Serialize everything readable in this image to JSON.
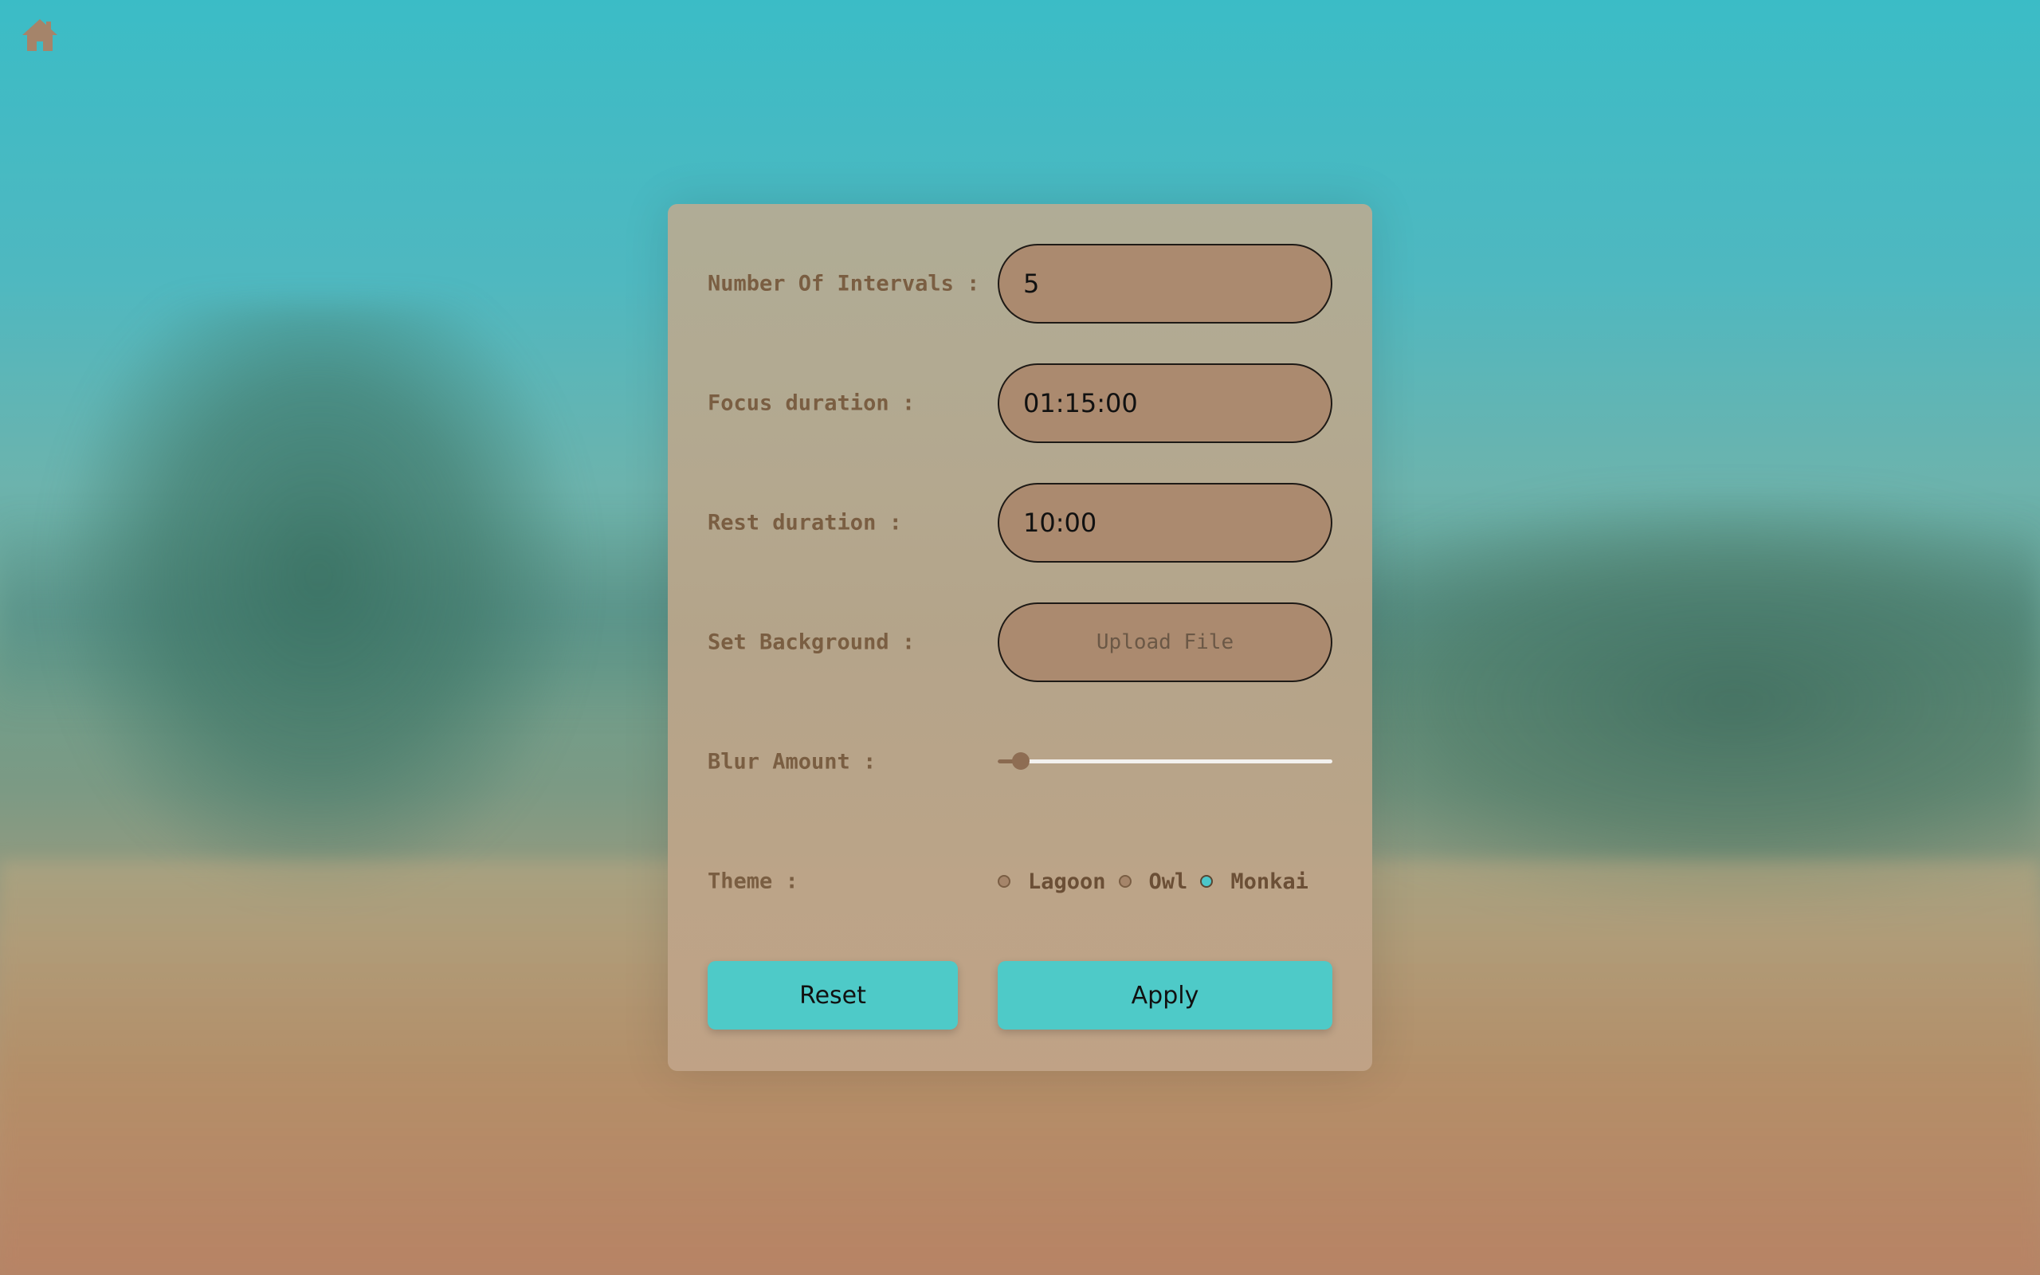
{
  "header": {
    "home_icon": "home-icon",
    "home_color": "#a5846a"
  },
  "settings": {
    "intervals": {
      "label": "Number Of Intervals :",
      "value": "5"
    },
    "focus": {
      "label": "Focus duration :",
      "value": "01:15:00"
    },
    "rest": {
      "label": "Rest duration :",
      "value": "10:00"
    },
    "background": {
      "label": "Set Background :",
      "button_label": "Upload File"
    },
    "blur": {
      "label": "Blur Amount :",
      "value_fraction": 0.07
    },
    "theme": {
      "label": "Theme :",
      "options": [
        {
          "label": "Lagoon",
          "checked": false
        },
        {
          "label": "Owl",
          "checked": false
        },
        {
          "label": "Monkai",
          "checked": true
        }
      ]
    }
  },
  "actions": {
    "reset_label": "Reset",
    "apply_label": "Apply"
  },
  "colors": {
    "accent": "#4ecac8",
    "field_bg": "#ab8a6f",
    "label_text": "#7a5e42"
  }
}
